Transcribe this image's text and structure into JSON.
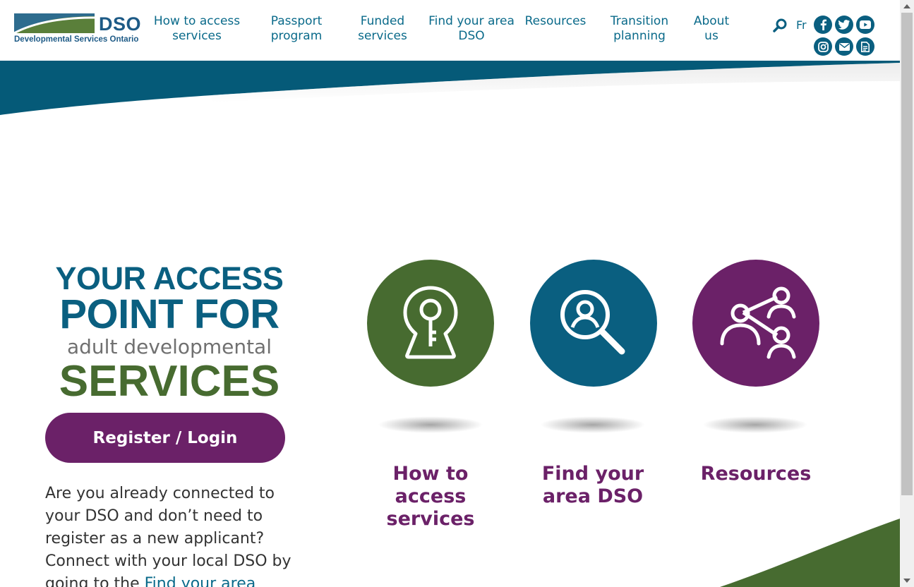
{
  "header": {
    "logo_text": "DSO",
    "logo_subtitle": "Developmental Services Ontario",
    "nav": [
      {
        "line1": "How to access",
        "line2": "services"
      },
      {
        "line1": "Passport",
        "line2": "program"
      },
      {
        "line1": "Funded",
        "line2": "services"
      },
      {
        "line1": "Find your area",
        "line2": "DSO"
      },
      {
        "line1": "Resources",
        "line2": ""
      },
      {
        "line1": "Transition",
        "line2": "planning"
      },
      {
        "line1": "About",
        "line2": "us"
      }
    ],
    "language_link": "Fr",
    "social_icons": [
      "facebook-icon",
      "twitter-icon",
      "youtube-icon",
      "instagram-icon",
      "email-icon",
      "document-icon"
    ]
  },
  "hero": {
    "line1": "YOUR ACCESS",
    "line2": "POINT FOR",
    "line3": "adult developmental",
    "line4": "SERVICES",
    "register_label": "Register / Login",
    "intro_text": "Are you already connected to your DSO and don’t need to register as a new applicant? Connect with your local DSO by going to the ",
    "intro_link": "Find your area"
  },
  "cards": [
    {
      "icon": "keyhole-icon",
      "color": "#476b30",
      "label": "How to access services"
    },
    {
      "icon": "search-person-icon",
      "color": "#0a5f80",
      "label": "Find your area DSO"
    },
    {
      "icon": "network-people-icon",
      "color": "#6b2168",
      "label": "Resources"
    }
  ],
  "colors": {
    "brand_blue": "#0a5f80",
    "brand_green": "#476b30",
    "brand_purple": "#6b2168"
  }
}
